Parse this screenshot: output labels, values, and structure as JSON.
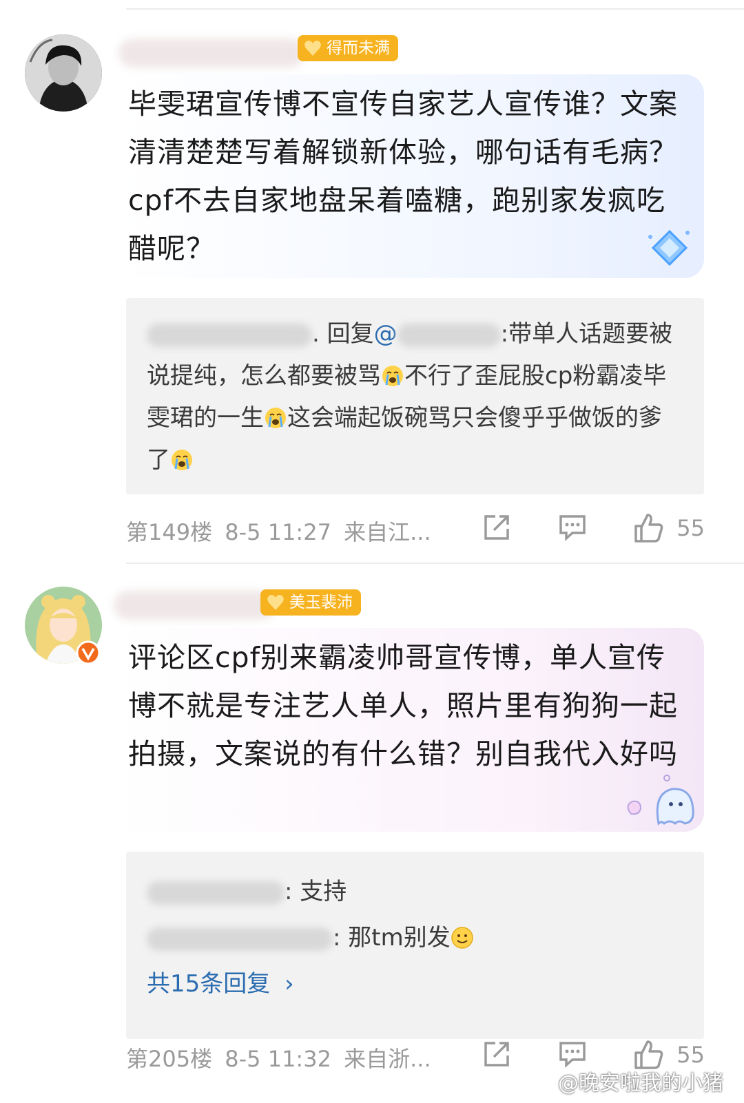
{
  "comments": [
    {
      "badge": "得而未满",
      "body": "毕雯珺宣传博不宣传自家艺人宣传谁？文案清清楚楚写着解锁新体验，哪句话有毛病？cpf不去自家地盘呆着嗑糖，跑别家发疯吃醋呢？",
      "reply": {
        "reply_word": "回复",
        "at": "@",
        "text_after": "带单人话题要被说提纯，怎么都要被骂",
        "text_mid": "不行了歪屁股cp粉霸凌毕雯珺的一生",
        "text_end": "这会端起饭碗骂只会傻乎乎做饭的爹了"
      },
      "footer": {
        "floor": "第149楼",
        "time": "8-5 11:27",
        "source": "来自江...",
        "likes": "55"
      }
    },
    {
      "badge": "美玉裴沛",
      "body": "评论区cpf别来霸凌帅哥宣传博，单人宣传博不就是专注艺人单人，照片里有狗狗一起拍摄，文案说的有什么错？别自我代入好吗",
      "replies": [
        {
          "text": "支持"
        },
        {
          "text": "那tm别发"
        }
      ],
      "more": "共15条回复",
      "footer": {
        "floor": "第205楼",
        "time": "8-5 11:32",
        "source": "来自浙...",
        "likes": "55"
      }
    }
  ],
  "watermark": "@晚安啦我的小猪",
  "icons": [
    "share-icon",
    "comment-icon",
    "like-icon",
    "cry-emoji-icon",
    "smile-emoji-icon",
    "verified-icon",
    "diamond-sticker-icon",
    "ghost-sticker-icon"
  ],
  "colors": {
    "badge": "#f7b21f",
    "link": "#2b6cb0",
    "meta": "#9a9a9a",
    "verified": "#f26a1b"
  }
}
